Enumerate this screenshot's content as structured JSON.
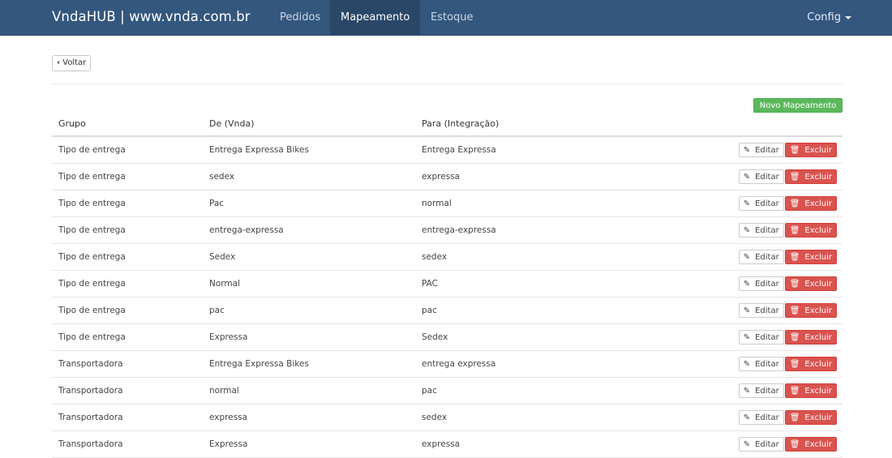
{
  "navbar": {
    "brand": "VndaHUB  | www.vnda.com.br",
    "items": [
      {
        "label": "Pedidos"
      },
      {
        "label": "Mapeamento"
      },
      {
        "label": "Estoque"
      }
    ],
    "config_label": "Config"
  },
  "back_label": "Voltar",
  "new_button_label": "Novo Mapeamento",
  "table": {
    "headers": [
      "Grupo",
      "De (Vnda)",
      "Para (Integração)"
    ],
    "edit_label": "Editar",
    "delete_label": "Excluir",
    "rows": [
      [
        "Tipo de entrega",
        "Entrega Expressa Bikes",
        "Entrega Expressa"
      ],
      [
        "Tipo de entrega",
        "sedex",
        "expressa"
      ],
      [
        "Tipo de entrega",
        "Pac",
        "normal"
      ],
      [
        "Tipo de entrega",
        "entrega-expressa",
        "entrega-expressa"
      ],
      [
        "Tipo de entrega",
        "Sedex",
        "sedex"
      ],
      [
        "Tipo de entrega",
        "Normal",
        "PAC"
      ],
      [
        "Tipo de entrega",
        "pac",
        "pac"
      ],
      [
        "Tipo de entrega",
        "Expressa",
        "Sedex"
      ],
      [
        "Transportadora",
        "Entrega Expressa Bikes",
        "entrega expressa"
      ],
      [
        "Transportadora",
        "normal",
        "pac"
      ],
      [
        "Transportadora",
        "expressa",
        "sedex"
      ],
      [
        "Transportadora",
        "Expressa",
        "expressa"
      ]
    ]
  },
  "colors": {
    "navbar": "#34577e",
    "success": "#5cb85c",
    "danger": "#d9534f"
  },
  "icons": {
    "back": "chevron-left-icon",
    "edit": "pencil-icon",
    "delete": "trash-icon",
    "dropdown": "caret-down-icon"
  }
}
